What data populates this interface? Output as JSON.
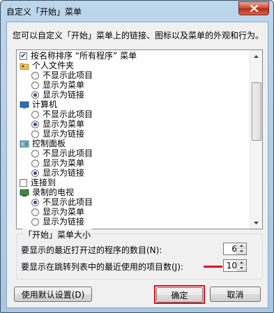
{
  "window": {
    "title": "自定义「开始」菜单"
  },
  "description": "您可以自定义「开始」菜单上的链接、图标以及菜单的外观和行为。",
  "list": {
    "items": [
      {
        "kind": "checkbox",
        "label": "按名称排序 “所有程序” 菜单",
        "checked": true
      },
      {
        "kind": "category",
        "label": "个人文件夹",
        "icon": "personal-folder-icon"
      },
      {
        "kind": "radio",
        "label": "不显示此项目",
        "checked": false
      },
      {
        "kind": "radio",
        "label": "显示为菜单",
        "checked": false
      },
      {
        "kind": "radio",
        "label": "显示为链接",
        "checked": true
      },
      {
        "kind": "category",
        "label": "计算机",
        "icon": "computer-icon"
      },
      {
        "kind": "radio",
        "label": "不显示此项目",
        "checked": false
      },
      {
        "kind": "radio",
        "label": "显示为菜单",
        "checked": true
      },
      {
        "kind": "radio",
        "label": "显示为链接",
        "checked": false
      },
      {
        "kind": "category",
        "label": "控制面板",
        "icon": "control-panel-icon"
      },
      {
        "kind": "radio",
        "label": "不显示此项目",
        "checked": false
      },
      {
        "kind": "radio",
        "label": "显示为菜单",
        "checked": false
      },
      {
        "kind": "radio",
        "label": "显示为链接",
        "checked": true
      },
      {
        "kind": "checkbox",
        "label": "连接到",
        "checked": false
      },
      {
        "kind": "category",
        "label": "录制的电视",
        "icon": "tv-icon"
      },
      {
        "kind": "radio",
        "label": "不显示此项目",
        "checked": true
      },
      {
        "kind": "radio",
        "label": "显示为菜单",
        "checked": false
      },
      {
        "kind": "radio",
        "label": "显示为链接",
        "checked": false
      }
    ]
  },
  "size_group": {
    "legend": "「开始」菜单大小",
    "recent_programs_label": "要显示的最近打开过的程序的数目(N):",
    "recent_programs_value": "6",
    "jumplist_label": "要显示在跳转列表中的最近使用的项目数(J):",
    "jumplist_value": "10"
  },
  "buttons": {
    "defaults": "使用默认设置(D)",
    "ok": "确定",
    "cancel": "取消"
  },
  "colors": {
    "highlight_red": "#e4101d",
    "radio_dot": "#2b4f8c"
  }
}
